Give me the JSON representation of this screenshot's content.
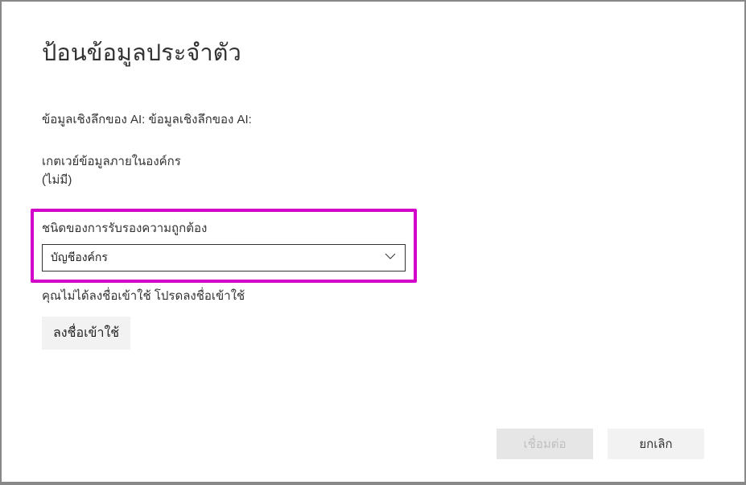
{
  "title": "ป้อนข้อมูลประจำตัว",
  "insights_line": "ข้อมูลเชิงลึกของ AI: ข้อมูลเชิงลึกของ AI:",
  "gateway": {
    "label": "เกตเวย์ข้อมูลภายในองค์กร",
    "value": "(ไม่มี)"
  },
  "auth": {
    "label": "ชนิดของการรับรองความถูกต้อง",
    "selected": "บัญชีองค์กร"
  },
  "signin": {
    "message": "คุณไม่ได้ลงชื่อเข้าใช้ โปรดลงชื่อเข้าใช้",
    "button": "ลงชื่อเข้าใช้"
  },
  "footer": {
    "connect": "เชื่อมต่อ",
    "cancel": "ยกเลิก"
  }
}
